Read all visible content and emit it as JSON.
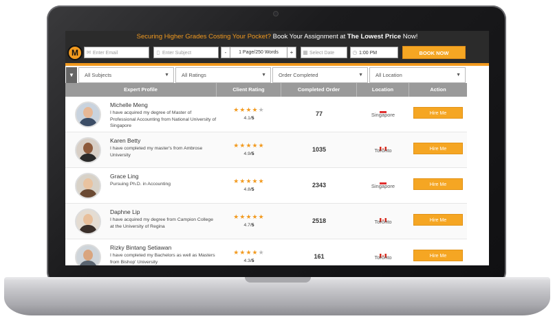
{
  "promo": {
    "highlight": "Securing Higher Grades Costing Your Pocket?",
    "text": " Book Your Assignment at ",
    "bold": "The Lowest Price",
    "end": " Now!"
  },
  "form": {
    "logo_letter": "M",
    "email_placeholder": "Enter Email",
    "subject_placeholder": "Enter Subject",
    "minus": "-",
    "pages": "1 Page/250 Words",
    "plus": "+",
    "date_placeholder": "Select Date",
    "time": "1:00 PM",
    "book_label": "BOOK NOW"
  },
  "filters": {
    "subjects": "All Subjects",
    "ratings": "All Ratings",
    "order": "Order Completed",
    "location": "All Location"
  },
  "table": {
    "headers": [
      "Expert Profile",
      "Client Rating",
      "Completed Order",
      "Location",
      "Action"
    ],
    "rows": [
      {
        "name": "Michelle Meng",
        "desc": "I have acquired my degree of Master of Professional Accounting from National University of Singapore",
        "rating_text": "4.1/",
        "rating_max": "5",
        "stars": 4,
        "orders": "77",
        "location": "Singapore",
        "country": "sg",
        "action": "Hire Me"
      },
      {
        "name": "Karen Betty",
        "desc": "I have completed my master's from Ambrose University",
        "rating_text": "4.9/",
        "rating_max": "5",
        "stars": 5,
        "orders": "1035",
        "location": "Toronto",
        "country": "ca",
        "action": "Hire Me"
      },
      {
        "name": "Grace Ling",
        "desc": "Pursuing Ph.D. in Accounting",
        "rating_text": "4.8/",
        "rating_max": "5",
        "stars": 5,
        "orders": "2343",
        "location": "Singapore",
        "country": "sg",
        "action": "Hire Me"
      },
      {
        "name": "Daphne Lip",
        "desc": "I have acquired my degree from Campion College at the University of Regina",
        "rating_text": "4.7/",
        "rating_max": "5",
        "stars": 4.5,
        "orders": "2518",
        "location": "Toronto",
        "country": "ca",
        "action": "Hire Me"
      },
      {
        "name": "Rizky Bintang Setiawan",
        "desc": "I have completed my Bachelors as well as Masters from Bishop' University",
        "rating_text": "4.3/",
        "rating_max": "5",
        "stars": 4,
        "orders": "161",
        "location": "Toronto",
        "country": "ca",
        "action": "Hire Me"
      }
    ]
  },
  "colors": {
    "accent": "#f29a1f",
    "header_bar": "#2b2b2b",
    "table_head": "#9a9a9a"
  }
}
